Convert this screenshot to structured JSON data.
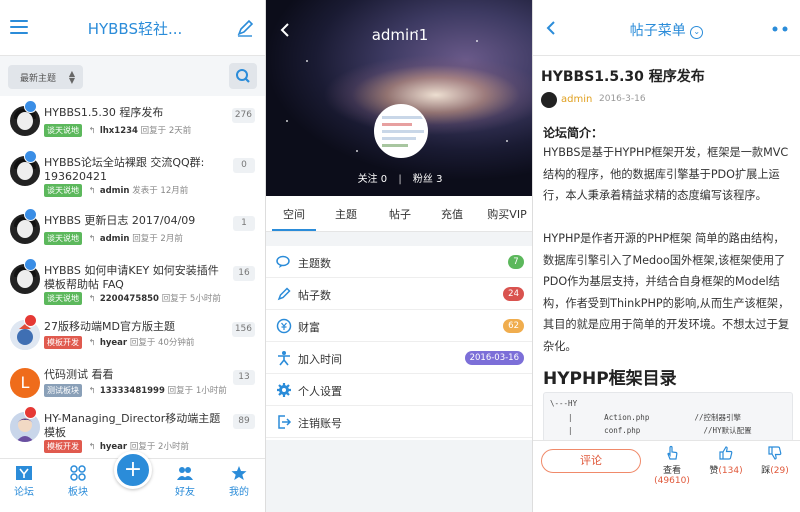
{
  "forum": {
    "title": "HYBBS轻社...",
    "sort_label": "最新主题",
    "topics": [
      {
        "title": "HYBBS1.5.30 程序发布",
        "tag": "谈天说地",
        "user": "lhx1234",
        "action": "回复于",
        "time": "2天前",
        "count": "276"
      },
      {
        "title": "HYBBS论坛全站裸跟 交流QQ群: 193620421",
        "tag": "谈天说地",
        "user": "admin",
        "action": "发表于",
        "time": "12月前",
        "count": "0"
      },
      {
        "title": "HYBBS 更新日志 2017/04/09",
        "tag": "谈天说地",
        "user": "admin",
        "action": "回复于",
        "time": "2月前",
        "count": "1"
      },
      {
        "title": "HYBBS 如何申请KEY 如何安装插件模板帮助帖 FAQ",
        "tag": "谈天说地",
        "user": "2200475850",
        "action": "回复于",
        "time": "5小时前",
        "count": "16"
      },
      {
        "title": "27版移动端MD官方版主题",
        "tag": "模板开发",
        "user": "hyear",
        "action": "回复于",
        "time": "40分钟前",
        "count": "156"
      },
      {
        "title": "代码测试 看看",
        "tag": "测试板块",
        "user": "13333481999",
        "action": "回复于",
        "time": "1小时前",
        "count": "13",
        "letter": "L"
      },
      {
        "title": "HY-Managing_Director移动端主题模板",
        "tag": "模板开发",
        "user": "hyear",
        "action": "回复于",
        "time": "2小时前",
        "count": "89"
      }
    ],
    "tabs": {
      "forum": "论坛",
      "board": "板块",
      "friends": "好友",
      "mine": "我的",
      "add": "+"
    }
  },
  "profile": {
    "username": "admin1",
    "follow_label": "关注",
    "follow_count": "0",
    "fans_label": "粉丝",
    "fans_count": "3",
    "separator": "|",
    "tabs": [
      "空间",
      "主题",
      "帖子",
      "充值",
      "购买VIP"
    ],
    "stats": [
      {
        "label": "主题数",
        "value": "7",
        "color": "#5cb85c"
      },
      {
        "label": "帖子数",
        "value": "24",
        "color": "#d9534f"
      },
      {
        "label": "财富",
        "value": "62",
        "color": "#f0ad4e"
      },
      {
        "label": "加入时间",
        "value": "2016-03-16",
        "color": "#7c6fd8"
      },
      {
        "label": "个人设置",
        "value": ""
      },
      {
        "label": "注销账号",
        "value": ""
      }
    ]
  },
  "post": {
    "menu_title": "帖子菜单",
    "title": "HYBBS1.5.30 程序发布",
    "author": "admin",
    "date": "2016-3-16",
    "section_head": "论坛简介：",
    "para1": "HYBBS是基于HYPHP框架开发，框架是一款MVC结构的程序，他的数据库引擎基于PDO扩展上运行，本人秉承着精益求精的态度编写该程序。",
    "para2": "HYPHP是作者开源的PHP框架 简单的路由结构，数据库引擎引入了Medoo国外框架,该框架使用了PDO作为基层支持，并结合自身框架的Model结构，作者受到ThinkPHP的影响,从而生产该框架，其目的就是应用于简单的开发环境。不想太过于复杂化。",
    "h2": "HYPHP框架目录",
    "code": [
      "\\---HY",
      "    |       Action.php          //控制器引擎",
      "    |       conf.php              //HY默认配置"
    ],
    "comment_label": "评论",
    "view_label": "查看",
    "view_count": "(49610)",
    "like_label": "赞",
    "like_count": "(134)",
    "dislike_label": "踩",
    "dislike_count": "(29)"
  },
  "colors": {
    "accent": "#2b8cd9",
    "orange": "#e0593b"
  }
}
